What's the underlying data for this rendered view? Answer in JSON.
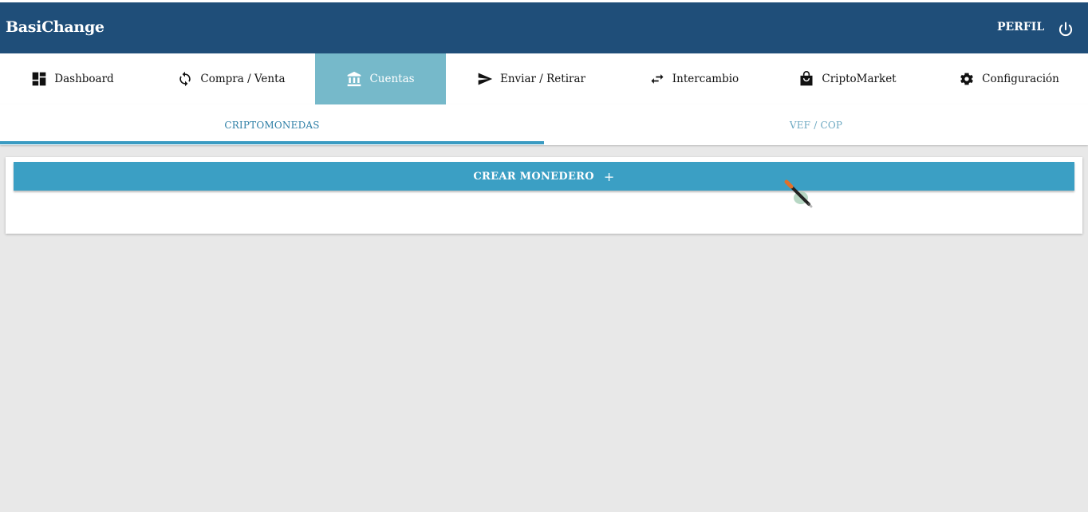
{
  "header": {
    "brand": "BasiChange",
    "profile_label": "PERFIL",
    "power_icon": "power-icon"
  },
  "nav": {
    "items": [
      {
        "label": "Dashboard",
        "icon": "dashboard-icon"
      },
      {
        "label": "Compra / Venta",
        "icon": "sync-icon"
      },
      {
        "label": "Cuentas",
        "icon": "bank-icon",
        "active": true
      },
      {
        "label": "Enviar / Retirar",
        "icon": "send-icon"
      },
      {
        "label": "Intercambio",
        "icon": "swap-icon"
      },
      {
        "label": "CriptoMarket",
        "icon": "shopping-bag-icon"
      },
      {
        "label": "Configuración",
        "icon": "gear-icon"
      }
    ]
  },
  "tabs": {
    "crypto": "CRIPTOMONEDAS",
    "fiat": "VEF / COP"
  },
  "main": {
    "create_wallet_label": "CREAR MONEDERO",
    "create_wallet_icon": "+"
  },
  "colors": {
    "header_bg": "#1f4e79",
    "active_nav_bg": "#76b9ca",
    "button_bg": "#3b9fc4",
    "tab_active": "#2e7fa6"
  }
}
